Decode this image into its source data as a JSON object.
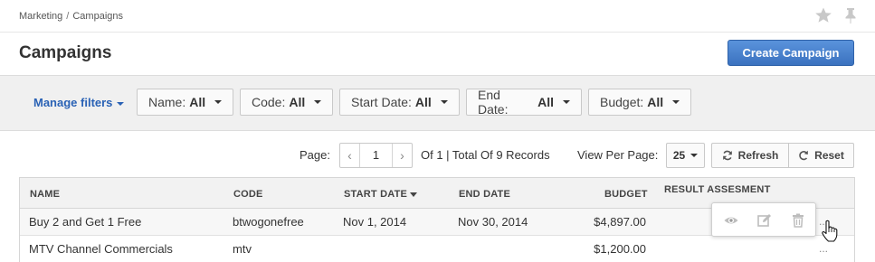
{
  "breadcrumb": {
    "parent": "Marketing",
    "separator": "/",
    "current": "Campaigns"
  },
  "header": {
    "title": "Campaigns",
    "create_label": "Create Campaign"
  },
  "filters": {
    "manage_label": "Manage filters",
    "items": [
      {
        "label": "Name:",
        "value": "All"
      },
      {
        "label": "Code:",
        "value": "All"
      },
      {
        "label": "Start Date:",
        "value": "All"
      },
      {
        "label": "End Date:",
        "value": "All"
      },
      {
        "label": "Budget:",
        "value": "All"
      }
    ]
  },
  "pagination": {
    "page_label": "Page:",
    "current_page": "1",
    "total_text": "Of 1 | Total Of 9 Records",
    "per_page_label": "View Per Page:",
    "per_page_value": "25",
    "refresh_label": "Refresh",
    "reset_label": "Reset"
  },
  "table": {
    "columns": [
      "NAME",
      "CODE",
      "START DATE",
      "END DATE",
      "BUDGET",
      "RESULT ASSESMENT"
    ],
    "rows": [
      {
        "name": "Buy 2 and Get 1 Free",
        "code": "btwogonefree",
        "start": "Nov 1, 2014",
        "end": "Nov 30, 2014",
        "budget": "$4,897.00",
        "more": "..."
      },
      {
        "name": "MTV Channel Commercials",
        "code": "mtv",
        "start": "",
        "end": "",
        "budget": "$1,200.00",
        "more": "..."
      }
    ]
  },
  "icons": {
    "star": "star-icon",
    "pin": "pin-icon",
    "view": "eye-icon",
    "edit": "edit-icon",
    "delete": "trash-icon",
    "refresh": "refresh-icon",
    "reset": "reset-icon",
    "cursor": "hand-cursor-icon"
  },
  "colors": {
    "accent": "#3b72bf",
    "link": "#2a62b5",
    "filter_bg": "#f0f0f0"
  }
}
